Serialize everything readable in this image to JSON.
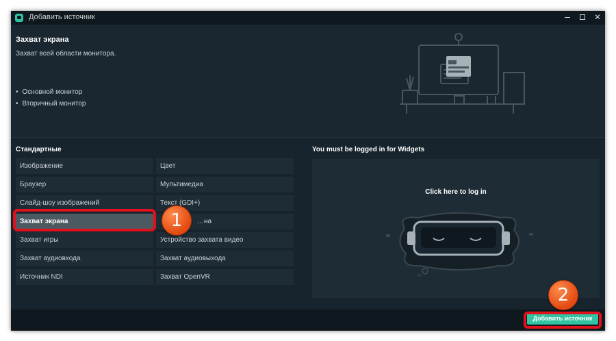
{
  "window": {
    "title": "Добавить источник",
    "close_glyph": "✕"
  },
  "source": {
    "title": "Захват экрана",
    "description": "Захват всей области монитора.",
    "options": [
      "Основной монитор",
      "Вторичный монитор"
    ],
    "bullet": "•"
  },
  "standard": {
    "title": "Стандартные",
    "left_items": [
      "Изображение",
      "Браузер",
      "Слайд-шоу изображений",
      "Захват экрана",
      "Захват игры",
      "Захват аудиовхода",
      "Источник NDI"
    ],
    "right_items": [
      "Цвет",
      "Мультимедиа",
      "Текст (GDI+)",
      "…на",
      "Устройство захвата видео",
      "Захват аудиовыхода",
      "Захват OpenVR"
    ],
    "selected": "Захват экрана"
  },
  "widgets": {
    "title": "You must be logged in for Widgets",
    "login_text": "Click here to log in"
  },
  "footer": {
    "add_button": "Добавить источник"
  },
  "annotations": {
    "badge1": "1",
    "badge2": "2",
    "highlight_color": "#e2111c",
    "badge_color": "#f2631f"
  },
  "colors": {
    "accent": "#31c3a2",
    "background": "#17242d"
  }
}
